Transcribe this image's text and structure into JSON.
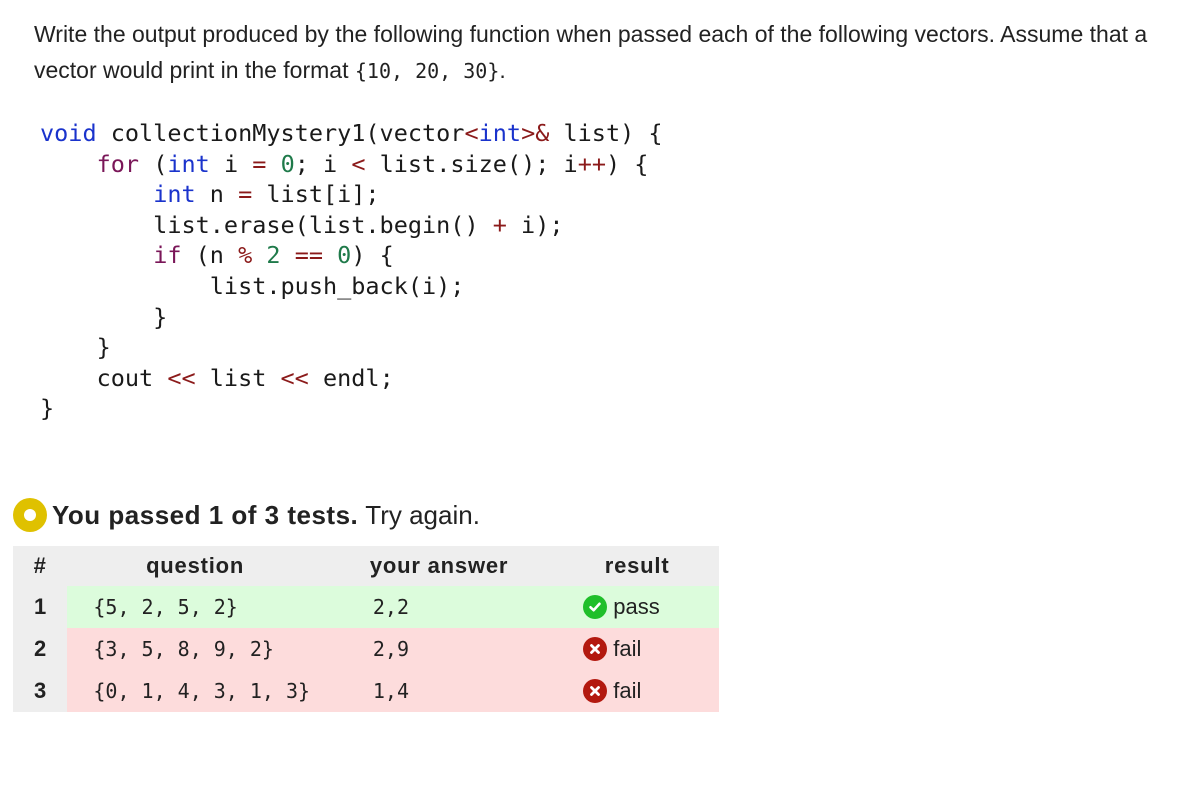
{
  "prompt": {
    "text_before": "Write the output produced by the following function when passed each of the following vectors. Assume that a vector would print in the format ",
    "format_example": "{10, 20, 30}",
    "text_after": "."
  },
  "code": {
    "lines": [
      [
        {
          "t": "void",
          "c": "kw-blue"
        },
        {
          "t": " collectionMystery1(vector"
        },
        {
          "t": "<",
          "c": "op-red"
        },
        {
          "t": "int",
          "c": "kw-blue"
        },
        {
          "t": ">&",
          "c": "op-red"
        },
        {
          "t": " list) {"
        }
      ],
      [
        {
          "t": "    "
        },
        {
          "t": "for",
          "c": "kw-purple"
        },
        {
          "t": " ("
        },
        {
          "t": "int",
          "c": "kw-blue"
        },
        {
          "t": " i "
        },
        {
          "t": "=",
          "c": "op-red"
        },
        {
          "t": " "
        },
        {
          "t": "0",
          "c": "num-green"
        },
        {
          "t": "; i "
        },
        {
          "t": "<",
          "c": "op-red"
        },
        {
          "t": " list.size(); i"
        },
        {
          "t": "++",
          "c": "op-red"
        },
        {
          "t": ") {"
        }
      ],
      [
        {
          "t": "        "
        },
        {
          "t": "int",
          "c": "kw-blue"
        },
        {
          "t": " n "
        },
        {
          "t": "=",
          "c": "op-red"
        },
        {
          "t": " list[i];"
        }
      ],
      [
        {
          "t": "        list.erase(list.begin() "
        },
        {
          "t": "+",
          "c": "op-red"
        },
        {
          "t": " i);"
        }
      ],
      [
        {
          "t": "        "
        },
        {
          "t": "if",
          "c": "kw-purple"
        },
        {
          "t": " (n "
        },
        {
          "t": "%",
          "c": "op-red"
        },
        {
          "t": " "
        },
        {
          "t": "2",
          "c": "num-green"
        },
        {
          "t": " "
        },
        {
          "t": "==",
          "c": "op-red"
        },
        {
          "t": " "
        },
        {
          "t": "0",
          "c": "num-green"
        },
        {
          "t": ") {"
        }
      ],
      [
        {
          "t": "            list.push_back(i);"
        }
      ],
      [
        {
          "t": "        }"
        }
      ],
      [
        {
          "t": "    }"
        }
      ],
      [
        {
          "t": "    cout "
        },
        {
          "t": "<<",
          "c": "op-red"
        },
        {
          "t": " list "
        },
        {
          "t": "<<",
          "c": "op-red"
        },
        {
          "t": " endl;"
        }
      ],
      [
        {
          "t": "}"
        }
      ]
    ]
  },
  "summary": {
    "icon": "partial-status-icon",
    "status_color": "#dfc100",
    "passed_text": "You passed 1 of 3 tests.",
    "try_again": "Try again."
  },
  "results_table": {
    "headers": {
      "num": "#",
      "question": "question",
      "answer": "your answer",
      "result": "result"
    },
    "rows": [
      {
        "num": "1",
        "question": "{5, 2, 5, 2}",
        "answer": "2,2",
        "result": "pass",
        "status": "pass"
      },
      {
        "num": "2",
        "question": "{3, 5, 8, 9, 2}",
        "answer": "2,9",
        "result": "fail",
        "status": "fail"
      },
      {
        "num": "3",
        "question": "{0, 1, 4, 3, 1, 3}",
        "answer": "1,4",
        "result": "fail",
        "status": "fail"
      }
    ],
    "colors": {
      "pass_row": "#dcfcdc",
      "fail_row": "#fddcdc",
      "pass_icon": "#1fbf2a",
      "fail_icon": "#b3190f"
    }
  }
}
